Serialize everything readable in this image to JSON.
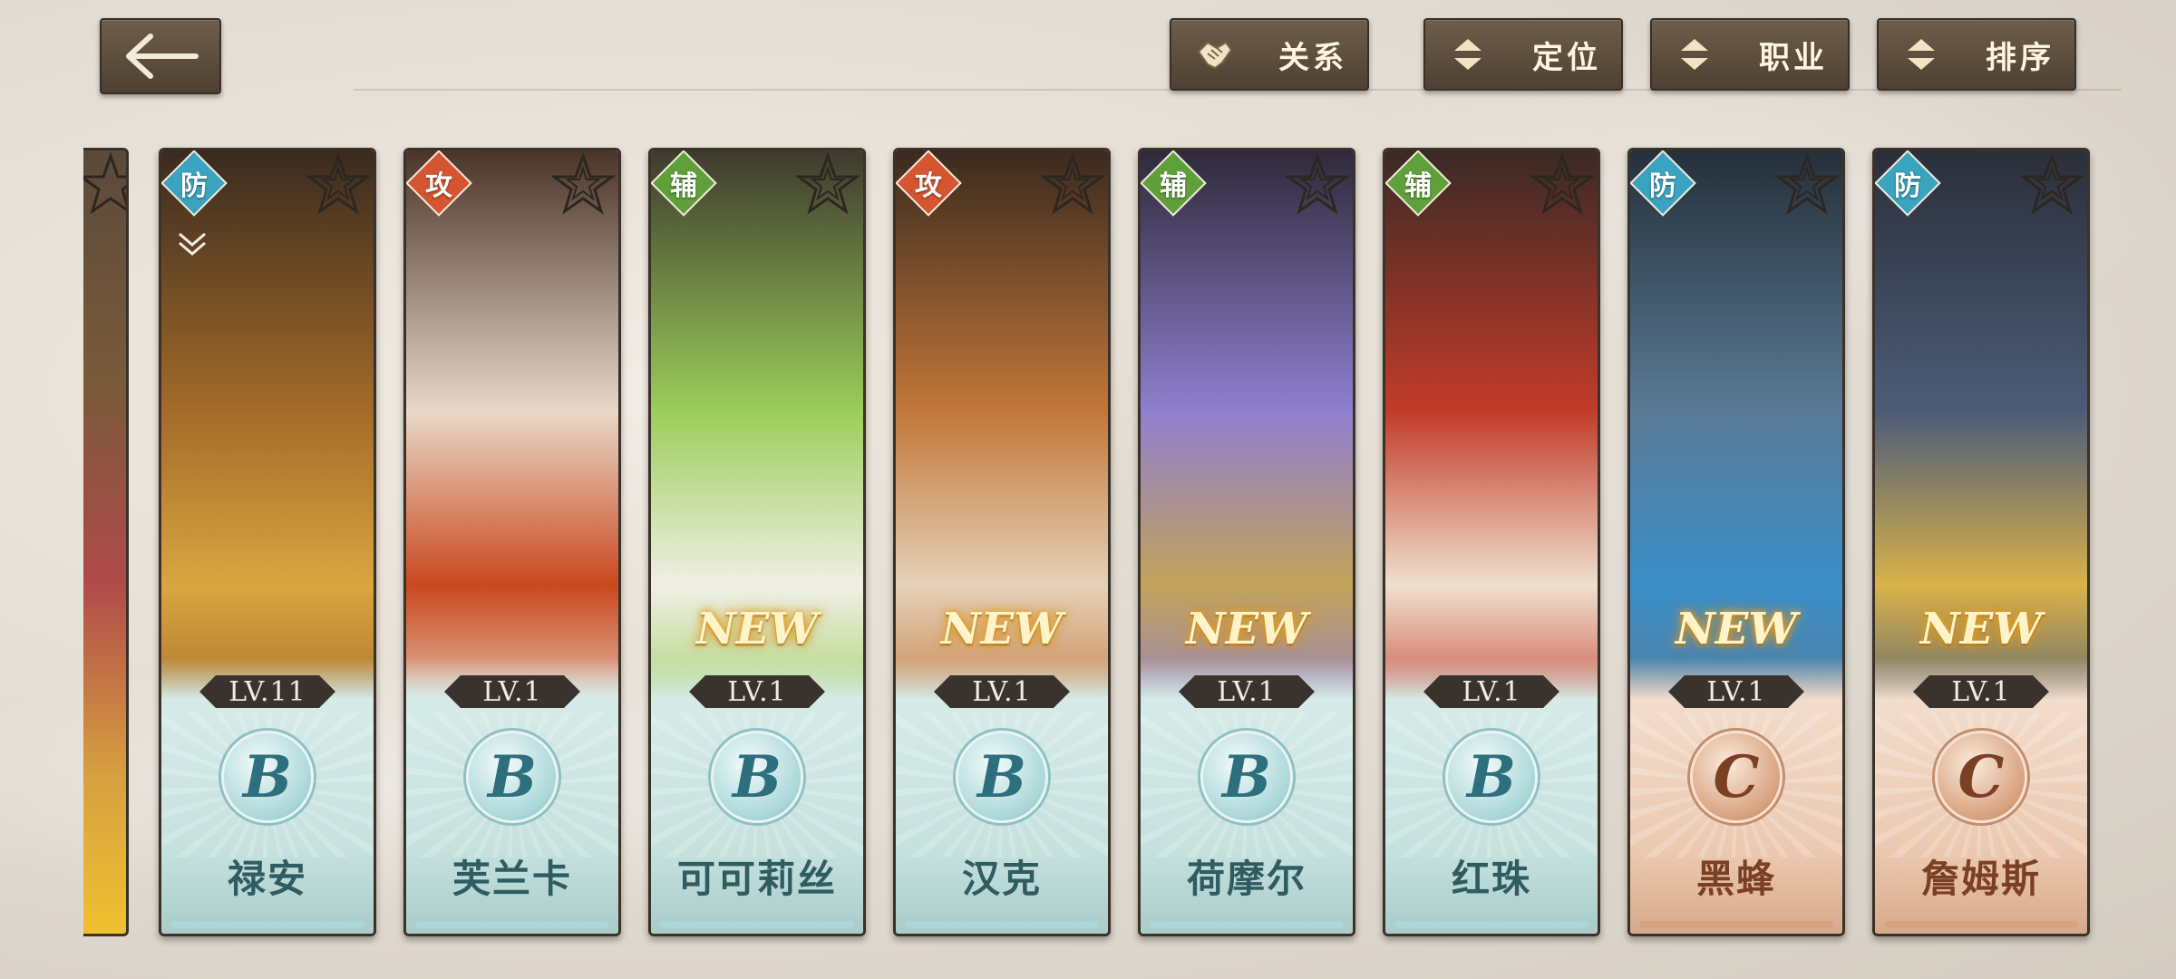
{
  "toolbar": {
    "relations": "关系",
    "position": "定位",
    "class": "职业",
    "sort": "排序"
  },
  "colors": {
    "def": "#3aa3bf",
    "atk": "#d4552f",
    "sup": "#5fa03a",
    "rank_b": "#aad7d8",
    "rank_c": "#d7a27e"
  },
  "characters": [
    {
      "name": "禄安",
      "role": "防",
      "level": "LV.11",
      "rank": "B",
      "new": "",
      "art": [
        "#3a2b20",
        "#a36b2a",
        "#d9a640"
      ]
    },
    {
      "name": "芙兰卡",
      "role": "攻",
      "level": "LV.1",
      "rank": "B",
      "new": "",
      "art": [
        "#4a3428",
        "#e8d8c8",
        "#c9481f"
      ]
    },
    {
      "name": "可可莉丝",
      "role": "辅",
      "level": "LV.1",
      "rank": "B",
      "new": "NEW",
      "art": [
        "#3d3a2e",
        "#9ccd5a",
        "#f1efe7"
      ]
    },
    {
      "name": "汉克",
      "role": "攻",
      "level": "LV.1",
      "rank": "B",
      "new": "NEW",
      "art": [
        "#3a2a1f",
        "#c2773a",
        "#e5d1b8"
      ]
    },
    {
      "name": "荷摩尔",
      "role": "辅",
      "level": "LV.1",
      "rank": "B",
      "new": "NEW",
      "art": [
        "#2f2a3a",
        "#8f7fd0",
        "#c3a35a"
      ]
    },
    {
      "name": "红珠",
      "role": "辅",
      "level": "LV.1",
      "rank": "B",
      "new": "",
      "art": [
        "#3a2a25",
        "#c33b2a",
        "#efe0cf"
      ]
    },
    {
      "name": "黑蜂",
      "role": "防",
      "level": "LV.1",
      "rank": "C",
      "new": "NEW",
      "art": [
        "#25303a",
        "#5a7a95",
        "#3a8fc9"
      ]
    },
    {
      "name": "詹姆斯",
      "role": "防",
      "level": "LV.1",
      "rank": "C",
      "new": "NEW",
      "art": [
        "#2b2f3a",
        "#4c5c78",
        "#d9b24a"
      ]
    }
  ]
}
